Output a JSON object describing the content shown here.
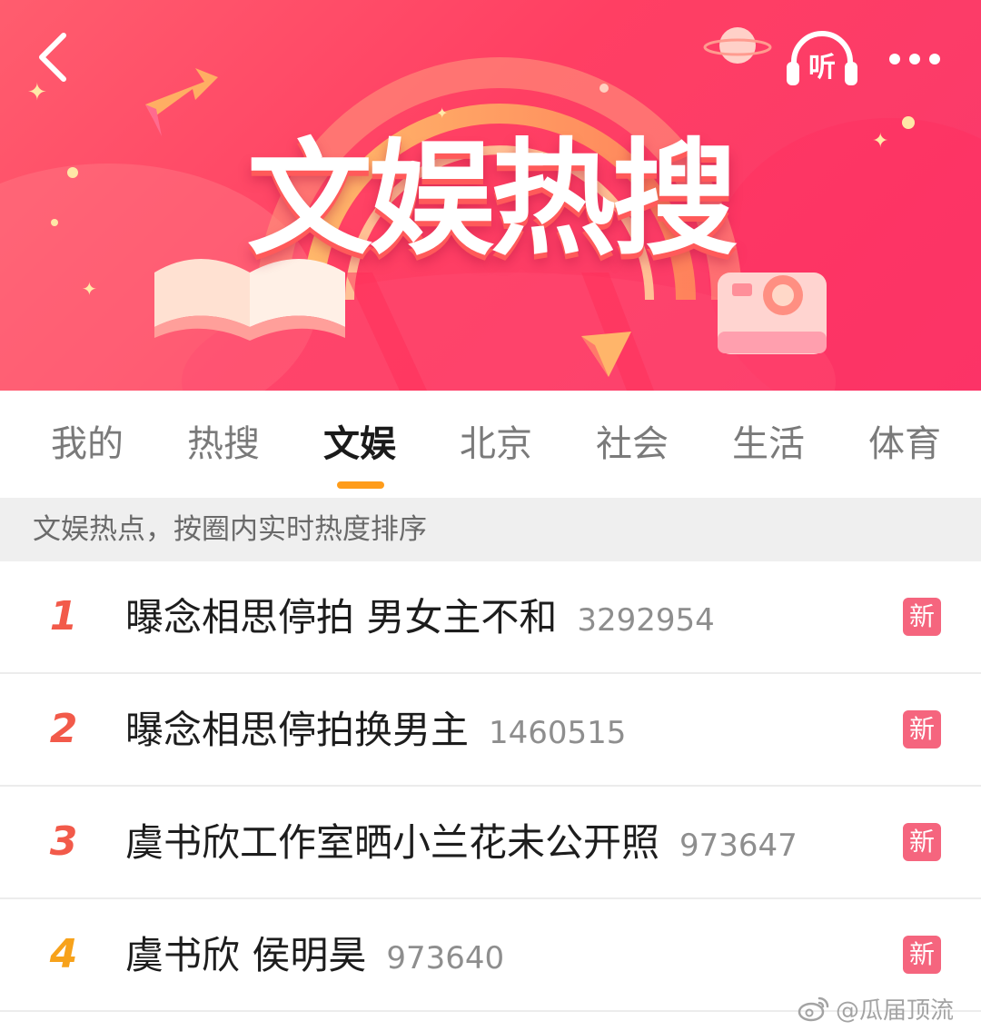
{
  "header": {
    "banner_title": "文娱热搜",
    "listen_label": "听",
    "icons": {
      "back": "back-arrow-icon",
      "listen": "headphones-icon",
      "more": "more-dots-icon"
    }
  },
  "tabs": [
    {
      "label": "我的",
      "active": false
    },
    {
      "label": "热搜",
      "active": false
    },
    {
      "label": "文娱",
      "active": true
    },
    {
      "label": "北京",
      "active": false
    },
    {
      "label": "社会",
      "active": false
    },
    {
      "label": "生活",
      "active": false
    },
    {
      "label": "体育",
      "active": false
    }
  ],
  "subtitle": "文娱热点，按圈内实时热度排序",
  "list": [
    {
      "rank": "1",
      "topic": "曝念相思停拍 男女主不和",
      "count": "3292954",
      "badge": "新"
    },
    {
      "rank": "2",
      "topic": "曝念相思停拍换男主",
      "count": "1460515",
      "badge": "新"
    },
    {
      "rank": "3",
      "topic": "虞书欣工作室晒小兰花未公开照",
      "count": "973647",
      "badge": "新"
    },
    {
      "rank": "4",
      "topic": "虞书欣 侯明昊",
      "count": "973640",
      "badge": "新"
    }
  ],
  "watermark": "@瓜届顶流",
  "colors": {
    "banner_red": "#ff3f63",
    "tab_underline": "#ff9c1a",
    "rank_red": "#f25a4a",
    "rank_orange": "#f7a21b",
    "badge_pink": "#f5657e"
  }
}
